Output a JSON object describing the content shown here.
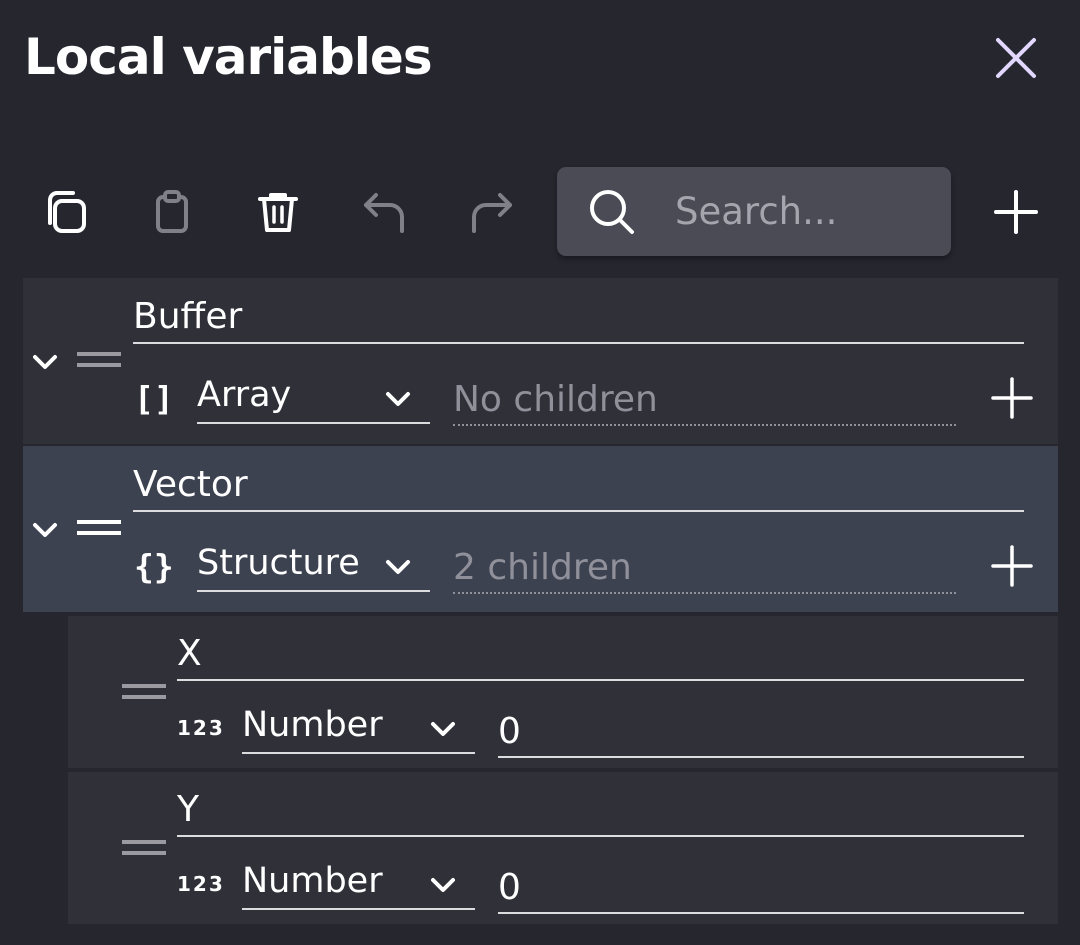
{
  "panel": {
    "title": "Local variables"
  },
  "toolbar": {
    "copy_icon": "copy-icon",
    "paste_icon": "clipboard-icon",
    "delete_icon": "trash-icon",
    "undo_icon": "undo-icon",
    "redo_icon": "redo-icon",
    "search_placeholder": "Search..."
  },
  "variables": [
    {
      "name": "Buffer",
      "type_icon": "[]",
      "type": "Array",
      "summary": "No children"
    },
    {
      "name": "Vector",
      "type_icon": "{}",
      "type": "Structure",
      "summary": "2 children"
    }
  ],
  "children": [
    {
      "name": "X",
      "type_icon": "123",
      "type": "Number",
      "value": "0"
    },
    {
      "name": "Y",
      "type_icon": "123",
      "type": "Number",
      "value": "0"
    }
  ],
  "colors": {
    "background": "#26262f",
    "row": "#303039",
    "row_selected": "#3d4250",
    "search_bg": "#4a4b55",
    "close_accent": "#e2d8ff"
  }
}
